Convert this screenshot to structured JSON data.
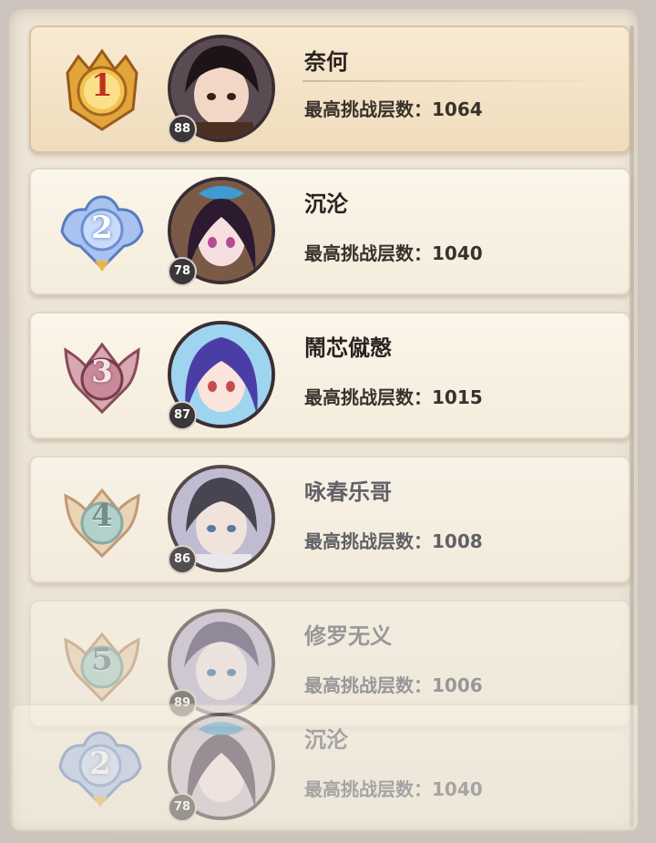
{
  "leaderboard": {
    "entries": [
      {
        "rank": "1",
        "name": "奈何",
        "level": "88",
        "score_label": "最高挑战层数：",
        "score": "1064",
        "badge": "gold-crown-badge",
        "accent": "#e6a53a"
      },
      {
        "rank": "2",
        "name": "沉沦",
        "level": "78",
        "score_label": "最高挑战层数：",
        "score": "1040",
        "badge": "silver-wing-badge",
        "accent": "#8fb0e8"
      },
      {
        "rank": "3",
        "name": "鬧芯僦慤",
        "level": "87",
        "score_label": "最高挑战层数：",
        "score": "1015",
        "badge": "bronze-horn-badge",
        "accent": "#c98a9a"
      },
      {
        "rank": "4",
        "name": "咏春乐哥",
        "level": "86",
        "score_label": "最高挑战层数：",
        "score": "1008",
        "badge": "plain-horn-badge",
        "accent": "#e5c8a0"
      },
      {
        "rank": "5",
        "name": "修罗无义",
        "level": "89",
        "score_label": "最高挑战层数：",
        "score": "1006",
        "badge": "plain-horn-badge",
        "accent": "#e5c8a0"
      },
      {
        "rank": "2",
        "name": "沉沦",
        "level": "78",
        "score_label": "最高挑战层数：",
        "score": "1040",
        "badge": "silver-wing-badge",
        "accent": "#8fb0e8"
      }
    ]
  }
}
